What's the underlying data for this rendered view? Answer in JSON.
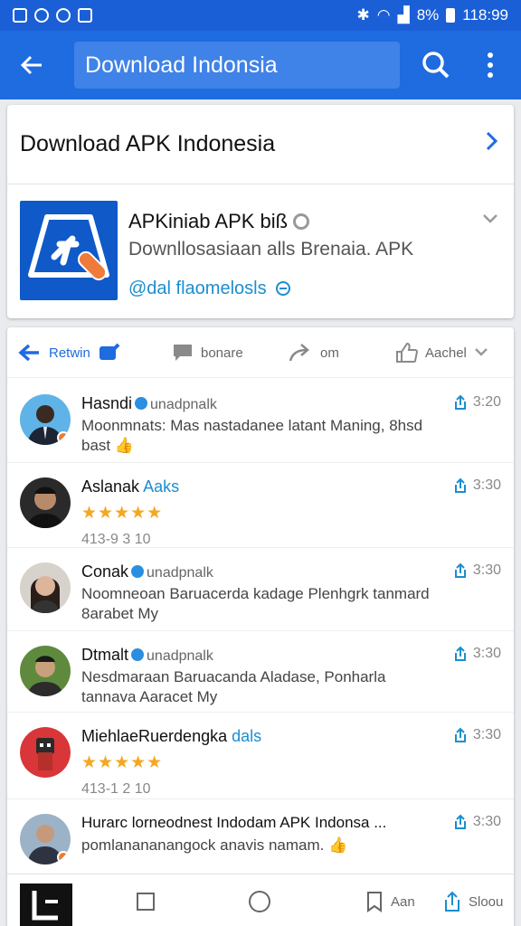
{
  "status_bar": {
    "battery": "8%",
    "time": "118:99"
  },
  "app_bar": {
    "title": "Download Indonsia"
  },
  "app_card": {
    "header": "Download APK Indonesia",
    "app_name": "APKiniab APK biß",
    "app_desc": "Downllosasiaan alls Brenaia. APK",
    "app_handle": "@dal flaomelosls"
  },
  "actions": {
    "retwin": "Retwin",
    "share": "bonare",
    "repost": "om",
    "like": "Aachel"
  },
  "comments": [
    {
      "name": "Hasndi",
      "sub": "unadpnalk",
      "text": "Moonmnats: Mas nastadanee latant Maning, 8hsd bast",
      "time": "3:20"
    },
    {
      "name": "Aslanak",
      "blue": "Aaks",
      "stars": "★★★★★",
      "meta": "413-9 3 10",
      "time": "3:30"
    },
    {
      "name": "Conak",
      "sub": "unadpnalk",
      "text": "Noomneoan Baruacerda kadage Plenhgrk tanmard 8arabet My",
      "time": "3:30"
    },
    {
      "name": "Dtmalt",
      "sub": "unadpnalk",
      "text": "Nesdmaraan Baruacanda Aladase, Ponharla tannava Aaracet My",
      "time": "3:30"
    },
    {
      "name": "MiehlaeRuerdengka",
      "blue": "dals",
      "stars": "★★★★★",
      "meta": "413-1 2 10",
      "time": "3:30"
    },
    {
      "name": "Hurarc lorneodnest Indodam APK Indonsa ...",
      "text": "pomlanananangock anavis namam.",
      "time": "3:30"
    }
  ],
  "nav": {
    "bookmark": "Aan",
    "share": "Sloou"
  }
}
